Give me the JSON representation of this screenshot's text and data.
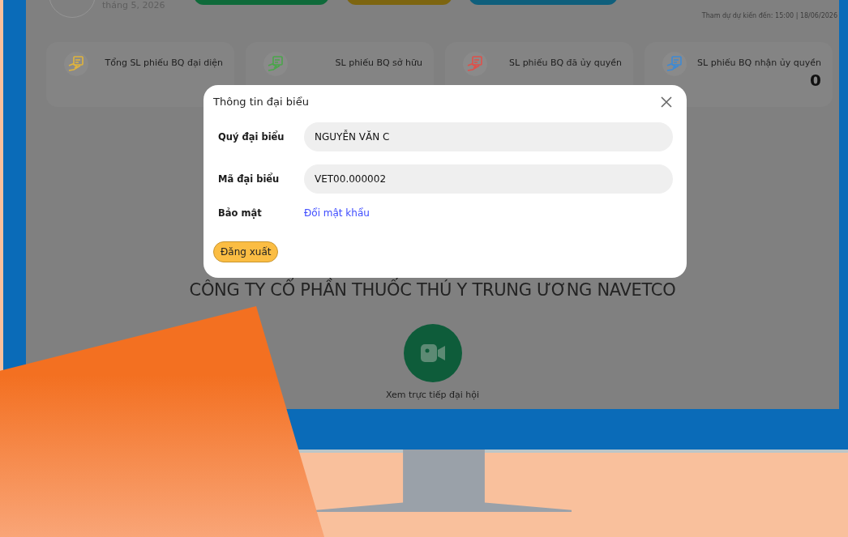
{
  "header": {
    "date": "tháng 5, 2026",
    "attendance": "Tham dự dự kiến đến: 15:00 | 18/06/2026"
  },
  "stats": [
    {
      "label": "Tổng SL phiếu BQ đại diện",
      "color": "#e0b43c"
    },
    {
      "label": "SL phiếu BQ sở hữu",
      "color": "#4aa64a"
    },
    {
      "label": "SL phiếu BQ đã ủy quyền",
      "color": "#e0504a"
    },
    {
      "label": "SL phiếu BQ nhận ủy quyền",
      "value": "0",
      "color": "#3d8ad6"
    }
  ],
  "company_name": "CÔNG TY CỔ PHẦN THUỐC THÚ Y TRUNG ƯƠNG NAVETCO",
  "live_button": {
    "label": "Xem trực tiếp đại hội"
  },
  "dialog": {
    "title": "Thông tin đại biểu",
    "fields": [
      {
        "label": "Quý đại biểu",
        "value": "NGUYỄN VĂN C"
      },
      {
        "label": "Mã đại biểu",
        "value": "VET00.000002"
      }
    ],
    "security": {
      "label": "Bảo mật",
      "link": "Đổi mật khẩu"
    },
    "logout_button": "Đăng xuất"
  }
}
